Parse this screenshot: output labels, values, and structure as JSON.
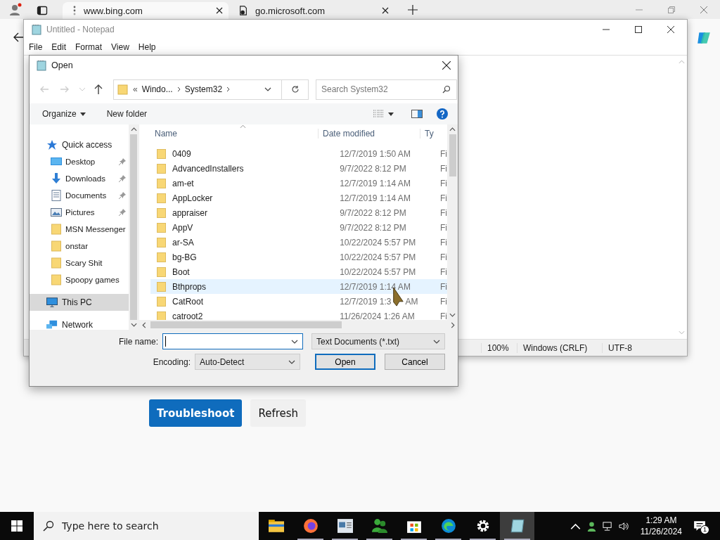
{
  "browser": {
    "tabs": [
      {
        "title": "www.bing.com",
        "selected": true
      },
      {
        "title": "go.microsoft.com",
        "selected": false
      }
    ],
    "page_buttons": [
      {
        "label": "Troubleshoot",
        "kind": "primary"
      },
      {
        "label": "Refresh",
        "kind": "secondary"
      }
    ]
  },
  "notepad": {
    "title": "Untitled - Notepad",
    "menu": [
      "File",
      "Edit",
      "Format",
      "View",
      "Help"
    ],
    "status_bar": [
      "100%",
      "Windows (CRLF)",
      "UTF-8"
    ]
  },
  "open_dialog": {
    "title": "Open",
    "breadcrumb_overflow": "«",
    "breadcrumb": [
      "Windo...",
      "System32"
    ],
    "search": {
      "placeholder": "Search System32"
    },
    "toolbar": {
      "organize": "Organize",
      "new_folder": "New folder"
    },
    "sidebar": [
      {
        "label": "Quick access",
        "kind": "star",
        "selected": false,
        "children": [
          {
            "label": "Desktop",
            "kind": "desktop",
            "pinned": true,
            "selected": false
          },
          {
            "label": "Downloads",
            "kind": "downloads",
            "pinned": true,
            "selected": false
          },
          {
            "label": "Documents",
            "kind": "documents",
            "pinned": true,
            "selected": false
          },
          {
            "label": "Pictures",
            "kind": "pictures",
            "pinned": true,
            "selected": false
          },
          {
            "label": "MSN Messenger",
            "kind": "folder",
            "pinned": false,
            "selected": false
          },
          {
            "label": "onstar",
            "kind": "folder",
            "pinned": false,
            "selected": false
          },
          {
            "label": "Scary Shit",
            "kind": "folder",
            "pinned": false,
            "selected": false
          },
          {
            "label": "Spoopy games",
            "kind": "folder",
            "pinned": false,
            "selected": false
          }
        ]
      },
      {
        "label": "This PC",
        "kind": "pc",
        "selected": true
      },
      {
        "label": "Network",
        "kind": "network",
        "selected": false
      }
    ],
    "columns": [
      "Name",
      "Date modified",
      "Ty"
    ],
    "files": [
      {
        "name": "0409",
        "date": "12/7/2019 1:50 AM",
        "type": "Fi",
        "hovered": false
      },
      {
        "name": "AdvancedInstallers",
        "date": "9/7/2022 8:12 PM",
        "type": "Fi",
        "hovered": false
      },
      {
        "name": "am-et",
        "date": "12/7/2019 1:14 AM",
        "type": "Fi",
        "hovered": false
      },
      {
        "name": "AppLocker",
        "date": "12/7/2019 1:14 AM",
        "type": "Fi",
        "hovered": false
      },
      {
        "name": "appraiser",
        "date": "9/7/2022 8:12 PM",
        "type": "Fi",
        "hovered": false
      },
      {
        "name": "AppV",
        "date": "9/7/2022 8:12 PM",
        "type": "Fi",
        "hovered": false
      },
      {
        "name": "ar-SA",
        "date": "10/22/2024 5:57 PM",
        "type": "Fi",
        "hovered": false
      },
      {
        "name": "bg-BG",
        "date": "10/22/2024 5:57 PM",
        "type": "Fi",
        "hovered": false
      },
      {
        "name": "Boot",
        "date": "10/22/2024 5:57 PM",
        "type": "Fi",
        "hovered": false
      },
      {
        "name": "Bthprops",
        "date": "12/7/2019 1:14 AM",
        "type": "Fi",
        "hovered": true
      },
      {
        "name": "CatRoot",
        "date_parts": [
          "12/7/2019 1:3",
          "AM"
        ],
        "type": "Fi",
        "hovered": false
      },
      {
        "name": "catroot2",
        "date": "11/26/2024 1:26 AM",
        "type": "Fi",
        "hovered": false
      }
    ],
    "file_name": {
      "label": "File name:"
    },
    "file_type": "Text Documents (*.txt)",
    "encoding": {
      "label": "Encoding:",
      "value": "Auto-Detect"
    },
    "buttons": [
      {
        "label": "Open",
        "kind": "default"
      },
      {
        "label": "Cancel",
        "kind": "normal"
      }
    ]
  },
  "taskbar": {
    "search": {
      "placeholder": "Type here to search"
    },
    "apps": [
      {
        "kind": "explorer",
        "running": false,
        "active": false
      },
      {
        "kind": "firefox",
        "running": true,
        "active": false
      },
      {
        "kind": "news",
        "running": true,
        "active": false
      },
      {
        "kind": "messenger",
        "running": true,
        "active": false
      },
      {
        "kind": "store",
        "running": true,
        "active": false
      },
      {
        "kind": "edge",
        "running": true,
        "active": false
      },
      {
        "kind": "settings",
        "running": true,
        "active": false
      },
      {
        "kind": "notepad",
        "running": true,
        "active": true
      }
    ],
    "time": "1:29 AM",
    "date": "11/26/2024",
    "notifications": "1"
  }
}
